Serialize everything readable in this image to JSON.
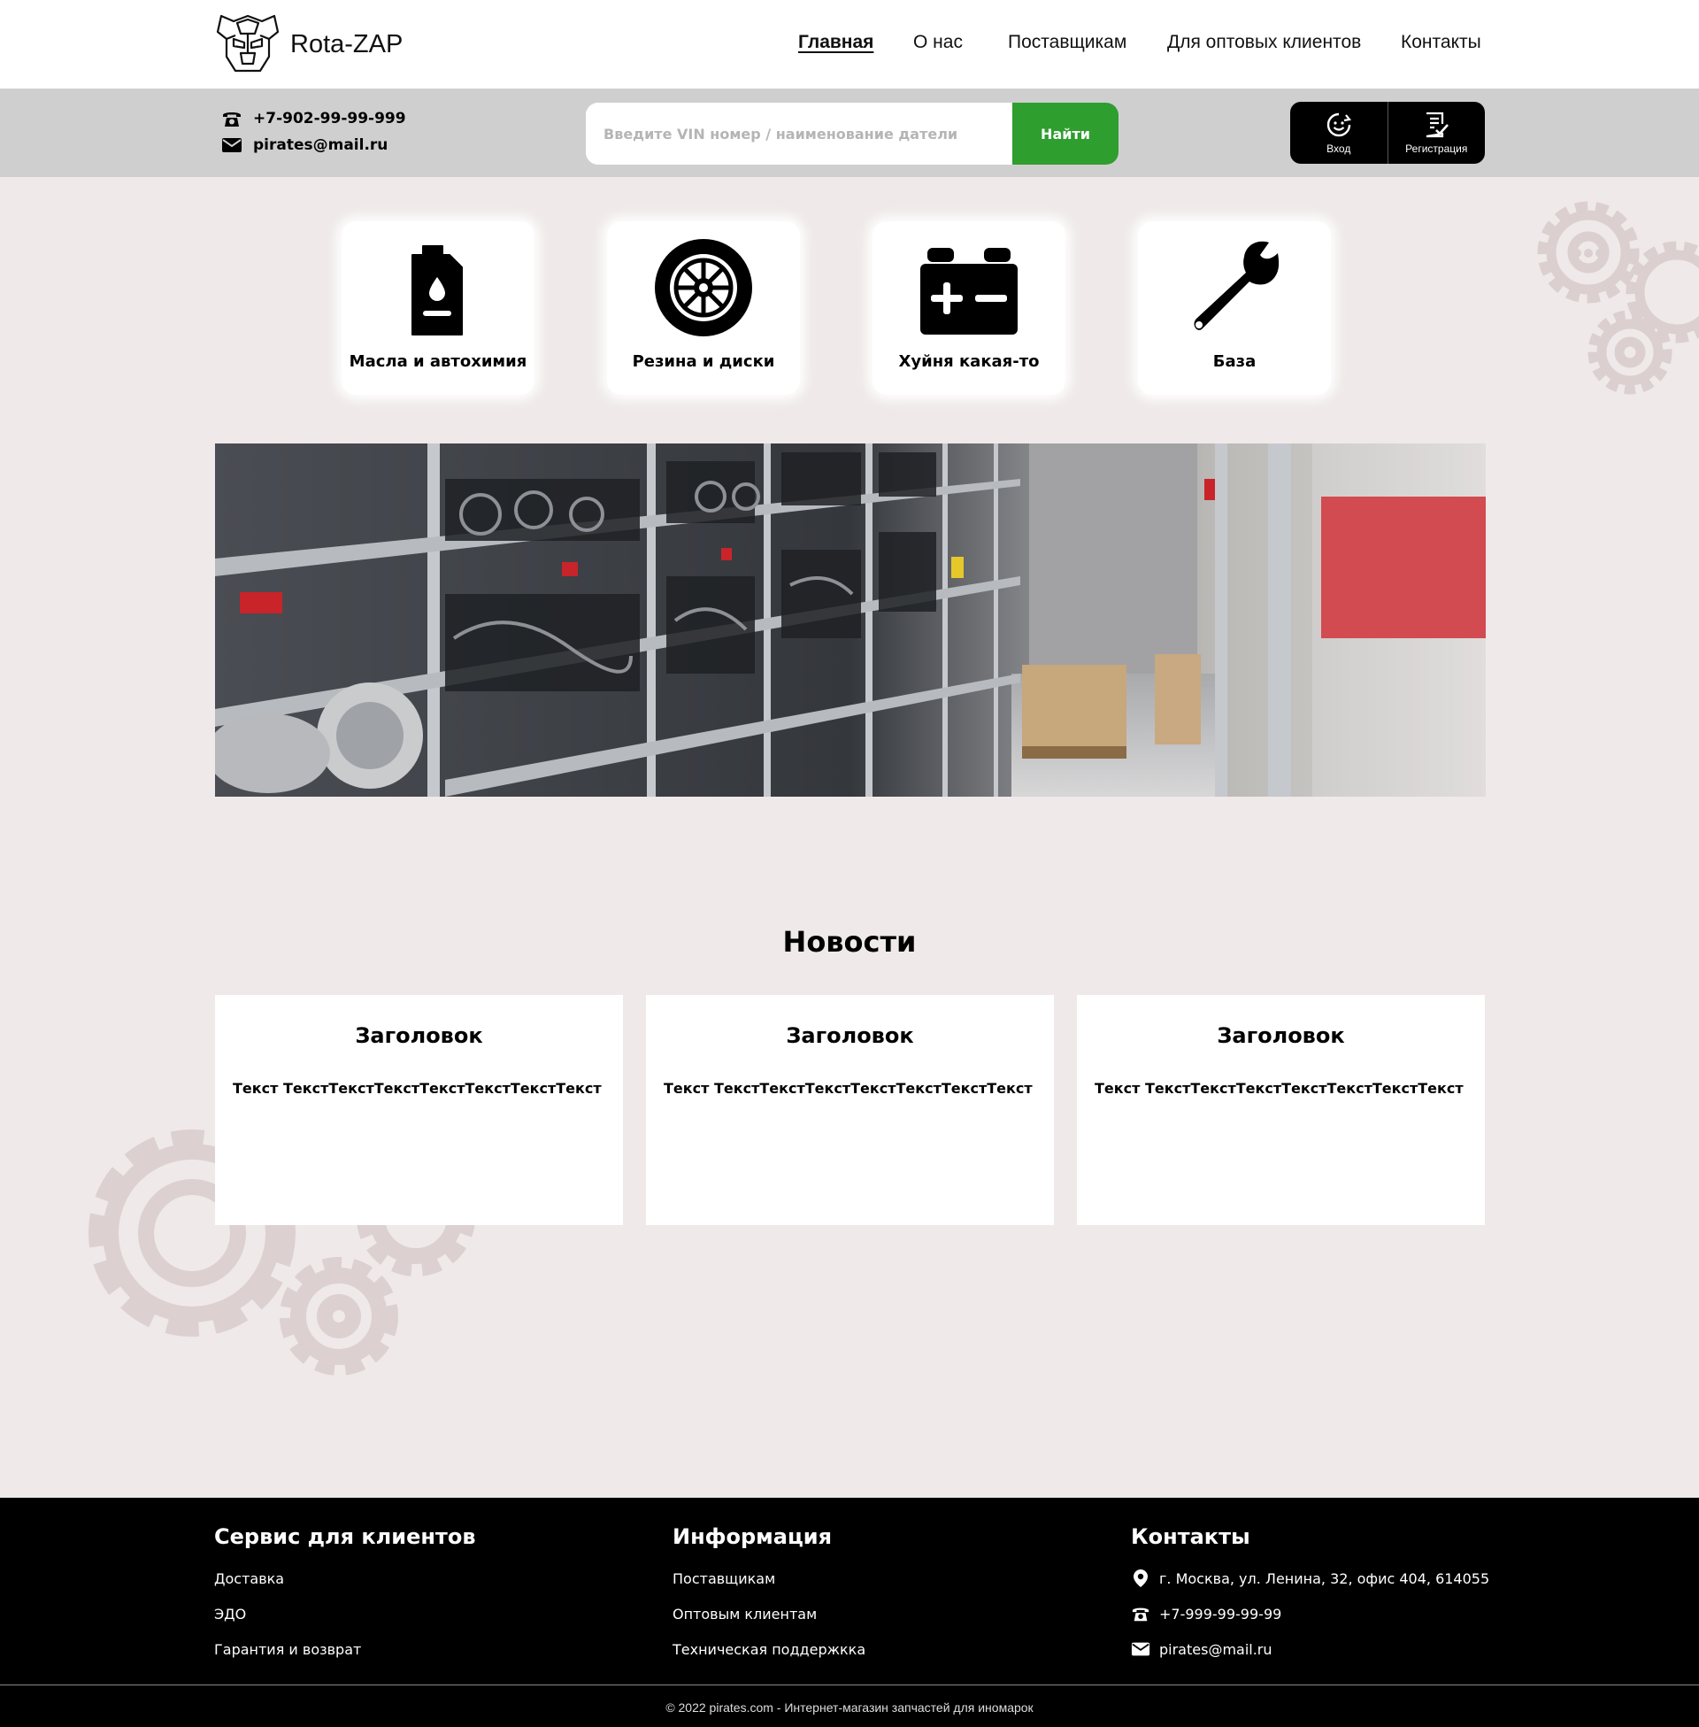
{
  "brand": {
    "name": "Rota-ZAP"
  },
  "nav": [
    "Главная",
    "О нас",
    "Поставщикам",
    "Для оптовых клиентов",
    "Контакты"
  ],
  "contacts": {
    "phone": "+7-902-99-99-999",
    "email": "pirates@mail.ru"
  },
  "search": {
    "placeholder": "Введите VIN номер / наименование датели",
    "button": "Найти"
  },
  "auth": {
    "login": "Вход",
    "register": "Регистрация"
  },
  "categories": [
    "Масла и автохимия",
    "Резина и диски",
    "Хуйня какая-то",
    "База"
  ],
  "news": {
    "title": "Новости",
    "items": [
      {
        "heading": "Заголовок",
        "text": "Текст ТекстТекстТекстТекстТекстТекстТекст"
      },
      {
        "heading": "Заголовок",
        "text": "Текст ТекстТекстТекстТекстТекстТекстТекст"
      },
      {
        "heading": "Заголовок",
        "text": "Текст ТекстТекстТекстТекстТекстТекстТекст"
      }
    ]
  },
  "footer": {
    "service": {
      "title": "Сервис для клиентов",
      "links": [
        "Доставка",
        "ЭДО",
        "Гарантия и возврат"
      ]
    },
    "info": {
      "title": "Информация",
      "links": [
        "Поставщикам",
        "Оптовым клиентам",
        "Техническая поддержкка"
      ]
    },
    "contacts": {
      "title": "Контакты",
      "address": "г. Москва, ул. Ленина, 32, офис 404, 614055",
      "phone": "+7-999-99-99-99",
      "email": "pirates@mail.ru"
    },
    "copyright": "© 2022 pirates.com - Интернет-магазин запчастей для иномарок"
  },
  "colors": {
    "accent": "#2e9e2f",
    "background": "#efe9e9",
    "infobar": "#d0cfd0",
    "footer": "#000000"
  }
}
